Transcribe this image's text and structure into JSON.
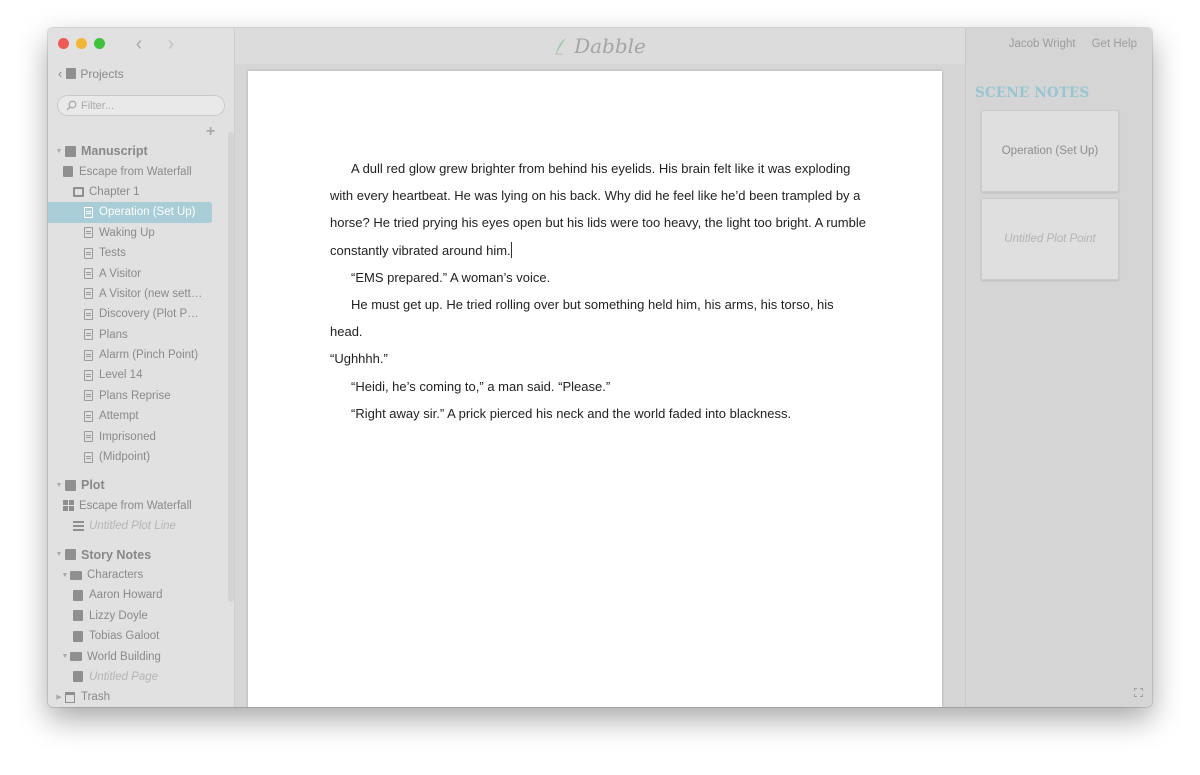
{
  "app": {
    "name": "Dabble"
  },
  "header": {
    "user_name": "Jacob Wright",
    "help_label": "Get Help"
  },
  "sidebar": {
    "projects_label": "Projects",
    "filter_placeholder": "Filter...",
    "tree": [
      {
        "label": "Manuscript",
        "type": "section",
        "icon": "manuscript-icon"
      },
      {
        "label": "Escape from Waterfall",
        "type": "book",
        "icon": "book-icon"
      },
      {
        "label": "Chapter 1",
        "type": "chapter",
        "icon": "chapter-icon"
      },
      {
        "label": "Operation (Set Up)",
        "type": "scene",
        "icon": "scene-icon",
        "selected": true
      },
      {
        "label": "Waking Up",
        "type": "scene",
        "icon": "scene-icon"
      },
      {
        "label": "Tests",
        "type": "scene",
        "icon": "scene-icon"
      },
      {
        "label": "A Visitor",
        "type": "scene",
        "icon": "scene-icon"
      },
      {
        "label": "A Visitor (new sett…",
        "type": "scene",
        "icon": "scene-icon"
      },
      {
        "label": "Discovery (Plot P…",
        "type": "scene",
        "icon": "scene-icon"
      },
      {
        "label": "Plans",
        "type": "scene",
        "icon": "scene-icon"
      },
      {
        "label": "Alarm (Pinch Point)",
        "type": "scene",
        "icon": "scene-icon"
      },
      {
        "label": "Level 14",
        "type": "scene",
        "icon": "scene-icon"
      },
      {
        "label": "Plans Reprise",
        "type": "scene",
        "icon": "scene-icon"
      },
      {
        "label": "Attempt",
        "type": "scene",
        "icon": "scene-icon"
      },
      {
        "label": "Imprisoned",
        "type": "scene",
        "icon": "scene-icon"
      },
      {
        "label": "(Midpoint)",
        "type": "scene",
        "icon": "scene-icon"
      },
      {
        "label": "Plot",
        "type": "section",
        "icon": "plot-icon"
      },
      {
        "label": "Escape from Waterfall",
        "type": "plotgrid",
        "icon": "plot-grid-icon"
      },
      {
        "label": "Untitled Plot Line",
        "type": "plotline",
        "icon": "plot-line-icon",
        "italic": true
      },
      {
        "label": "Story Notes",
        "type": "section",
        "icon": "story-notes-icon"
      },
      {
        "label": "Characters",
        "type": "folder",
        "icon": "folder-icon"
      },
      {
        "label": "Aaron Howard",
        "type": "note",
        "icon": "note-icon"
      },
      {
        "label": "Lizzy Doyle",
        "type": "note",
        "icon": "note-icon"
      },
      {
        "label": "Tobias Galoot",
        "type": "note",
        "icon": "note-icon"
      },
      {
        "label": "World Building",
        "type": "folder",
        "icon": "folder-icon"
      },
      {
        "label": "Untitled Page",
        "type": "note",
        "icon": "note-icon",
        "italic": true
      },
      {
        "label": "Trash",
        "type": "trash",
        "icon": "trash-icon"
      }
    ]
  },
  "editor": {
    "paragraphs": [
      "A dull red glow grew brighter from behind his eyelids. His brain felt like it was exploding with every heartbeat. He was lying on his back. Why did he feel like he’d been trampled by a horse? He tried prying his eyes open but his lids were too heavy, the light too bright. A rumble constantly vibrated around him.",
      "“EMS prepared.” A woman’s voice.",
      "He must get up. He tried rolling over but something held him, his arms, his torso, his head.",
      "“Ughhhh.”",
      "“Heidi, he’s coming to,” a man said. “Please.”",
      "“Right away sir.” A prick pierced his neck and the world faded into blackness."
    ]
  },
  "scene_notes": {
    "title": "SCENE NOTES",
    "cards": [
      {
        "label": "Operation (Set Up)",
        "italic": false
      },
      {
        "label": "Untitled Plot Point",
        "italic": true
      }
    ]
  },
  "colors": {
    "accent": "#95c6d1",
    "selection": "#a9cdd6"
  }
}
